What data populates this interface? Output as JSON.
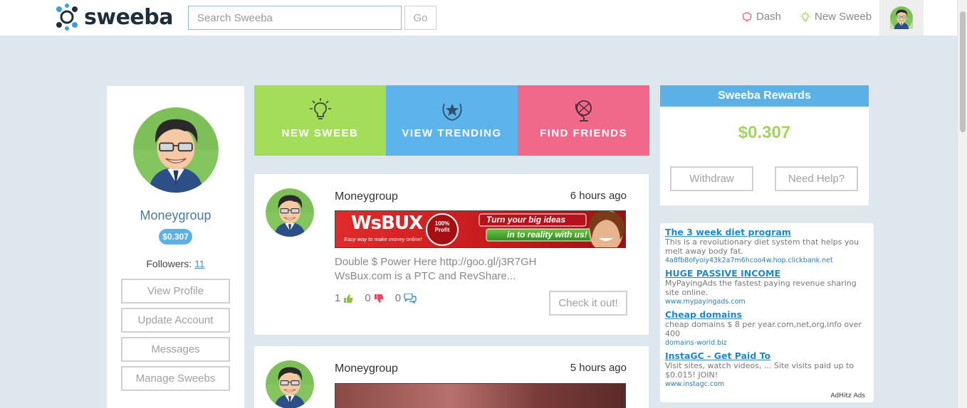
{
  "nav": {
    "logo_text": "sweeba",
    "search_placeholder": "Search Sweeba",
    "go_label": "Go",
    "dash_label": "Dash",
    "new_sweeb_label": "New Sweeb"
  },
  "profile": {
    "name": "Moneygroup",
    "balance": "$0.307",
    "followers_label": "Followers:",
    "followers_count": "11",
    "buttons": [
      "View Profile",
      "Update Account",
      "Messages",
      "Manage Sweebs"
    ]
  },
  "tiles": [
    {
      "label": "NEW SWEEB",
      "color": "#a3dd5a",
      "icon": "lightbulb-icon"
    },
    {
      "label": "VIEW TRENDING",
      "color": "#5db3ec",
      "icon": "star-wreath-icon"
    },
    {
      "label": "FIND FRIENDS",
      "color": "#f1698a",
      "icon": "globe-icon"
    }
  ],
  "posts": [
    {
      "author": "Moneygroup",
      "time": "6 hours ago",
      "banner_brand": "WsBUX",
      "banner_tagline": "Easy way to make money online!",
      "banner_badge": "100% Profit",
      "banner_line1": "Turn your big ideas",
      "banner_line2": "in to reality with us!",
      "text": "Double $ Power Here http://goo.gl/j3R7GH WsBux.com is a PTC and RevShare...",
      "likes": "1",
      "dislikes": "0",
      "comments": "0",
      "action_label": "Check it out!"
    },
    {
      "author": "Moneygroup",
      "time": "5 hours ago"
    }
  ],
  "rewards": {
    "title": "Sweeba Rewards",
    "amount": "$0.307",
    "withdraw_label": "Withdraw",
    "help_label": "Need Help?"
  },
  "ads": {
    "items": [
      {
        "title": "The 3 week diet program",
        "desc": "This is a revolutionary diet system that helps you melt away body fat.",
        "url": "4a8fb8ofyoiy43k2a7m6hcoo4w.hop.clickbank.net"
      },
      {
        "title": "HUGE PASSIVE INCOME",
        "desc": "MyPayingAds the fastest paying revenue sharing site online.",
        "url": "www.mypayingads.com"
      },
      {
        "title": "Cheap domains",
        "desc": "cheap domains $ 8 per year.com,net,org,info over 400",
        "url": "domains-world.biz"
      },
      {
        "title": "InstaGC - Get Paid To",
        "desc": "Visit sites, watch videos, ... Site visits paid up to $0.015! JOIN!",
        "url": "www.instagc.com"
      }
    ],
    "footer": "AdHitz Ads"
  },
  "colors": {
    "accent_blue": "#5bb0e6",
    "accent_green": "#a3d45b",
    "accent_pink": "#f1698a",
    "background": "#dfe7ee"
  }
}
